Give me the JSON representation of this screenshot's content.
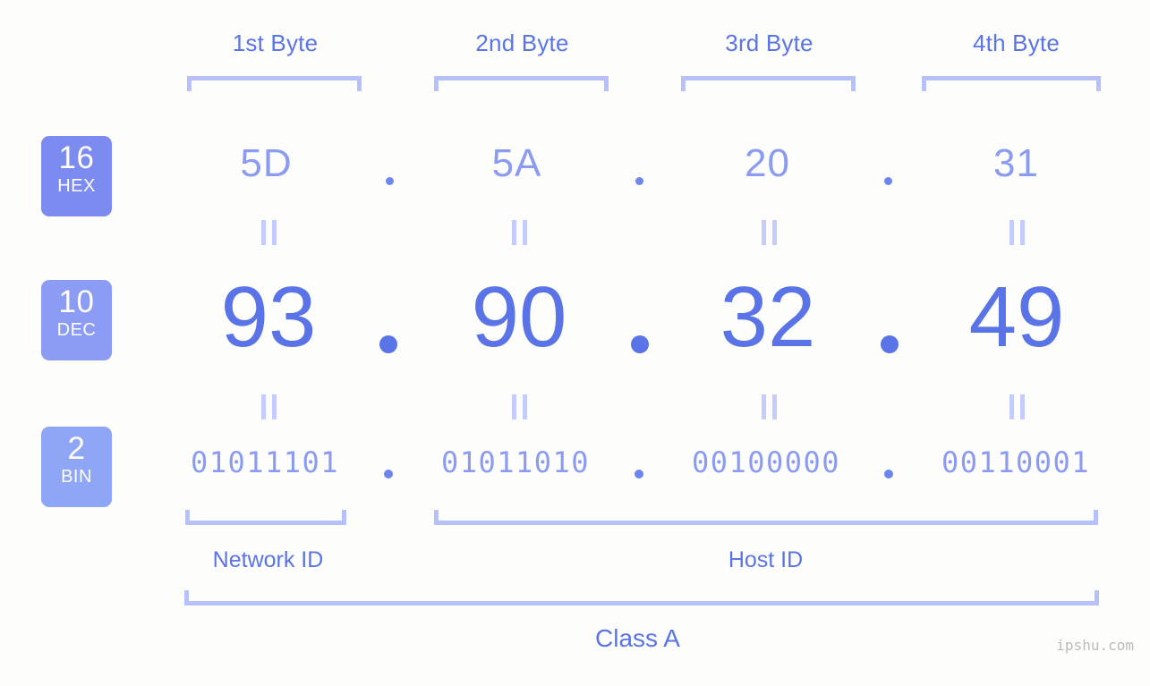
{
  "background_color": "#fdfefb",
  "accent_color": "#5a74e8",
  "muted_accent_color": "#8b9bf2",
  "bracket_color": "#b6c0fb",
  "byte_headers": [
    {
      "label": "1st Byte"
    },
    {
      "label": "2nd Byte"
    },
    {
      "label": "3rd Byte"
    },
    {
      "label": "4th Byte"
    }
  ],
  "rows": {
    "hex": {
      "badge_number": "16",
      "badge_abbr": "HEX",
      "badge_color": "#7b8bf0",
      "values": [
        "5D",
        "5A",
        "20",
        "31"
      ],
      "separator": "."
    },
    "dec": {
      "badge_number": "10",
      "badge_abbr": "DEC",
      "badge_color": "#8c9bf4",
      "values": [
        "93",
        "90",
        "32",
        "49"
      ],
      "separator": "."
    },
    "bin": {
      "badge_number": "2",
      "badge_abbr": "BIN",
      "badge_color": "#8fa6f7",
      "values": [
        "01011101",
        "01011010",
        "00100000",
        "00110001"
      ],
      "separator": "."
    }
  },
  "equals_symbol": "=",
  "sections": {
    "network_id": "Network ID",
    "host_id": "Host ID",
    "class": "Class A"
  },
  "watermark": "ipshu.com"
}
